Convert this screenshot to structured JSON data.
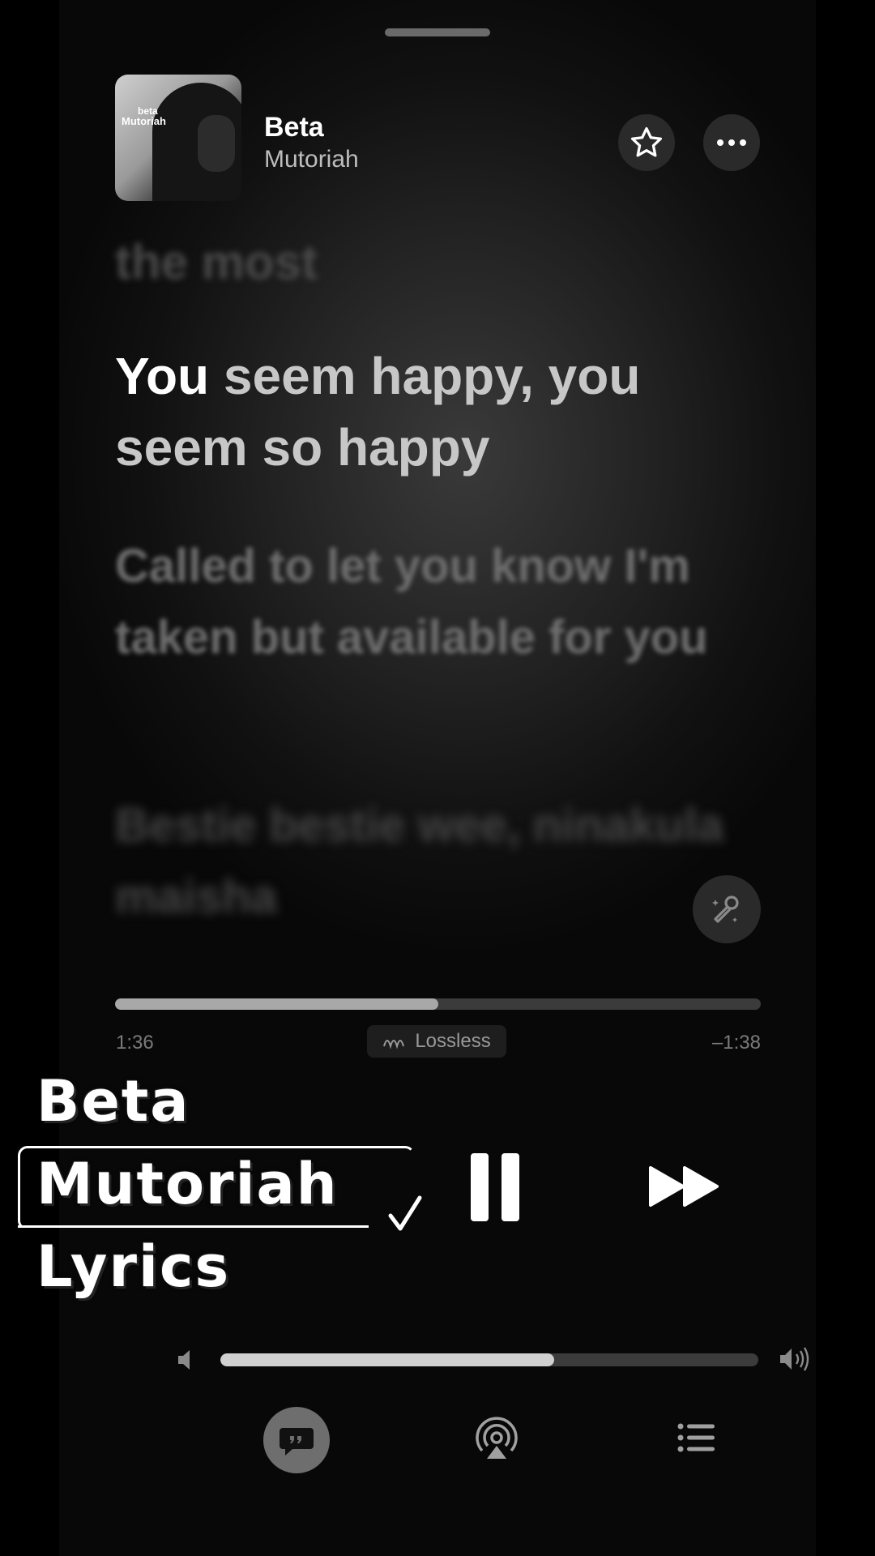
{
  "now_playing": {
    "album_art_text_top": "beta",
    "album_art_text_bottom": "Mutoriah",
    "title": "Beta",
    "artist": "Mutoriah"
  },
  "header_buttons": {
    "favorite_icon": "star-icon",
    "more_icon": "ellipsis-icon"
  },
  "lyrics": {
    "previous_line": "the most",
    "current_line_sung": "You",
    "current_line_rest": " seem happy, you seem so happy",
    "next_line": "Called to let you know I'm taken but available for you",
    "following_line": "Bestie bestie wee, ninakula maisha"
  },
  "playback": {
    "elapsed": "1:36",
    "remaining": "–1:38",
    "progress_fraction": 0.5,
    "quality_label": "Lossless"
  },
  "volume": {
    "level_fraction": 0.62
  },
  "bottom_tabs": {
    "lyrics_icon": "lyrics-quote-icon",
    "airplay_icon": "airplay-icon",
    "queue_icon": "list-icon"
  },
  "overlay": {
    "line1": "Beta",
    "line2": "Mutoriah",
    "line3": "Lyrics"
  },
  "colors": {
    "accent": "#ffffff",
    "background": "#111111"
  }
}
